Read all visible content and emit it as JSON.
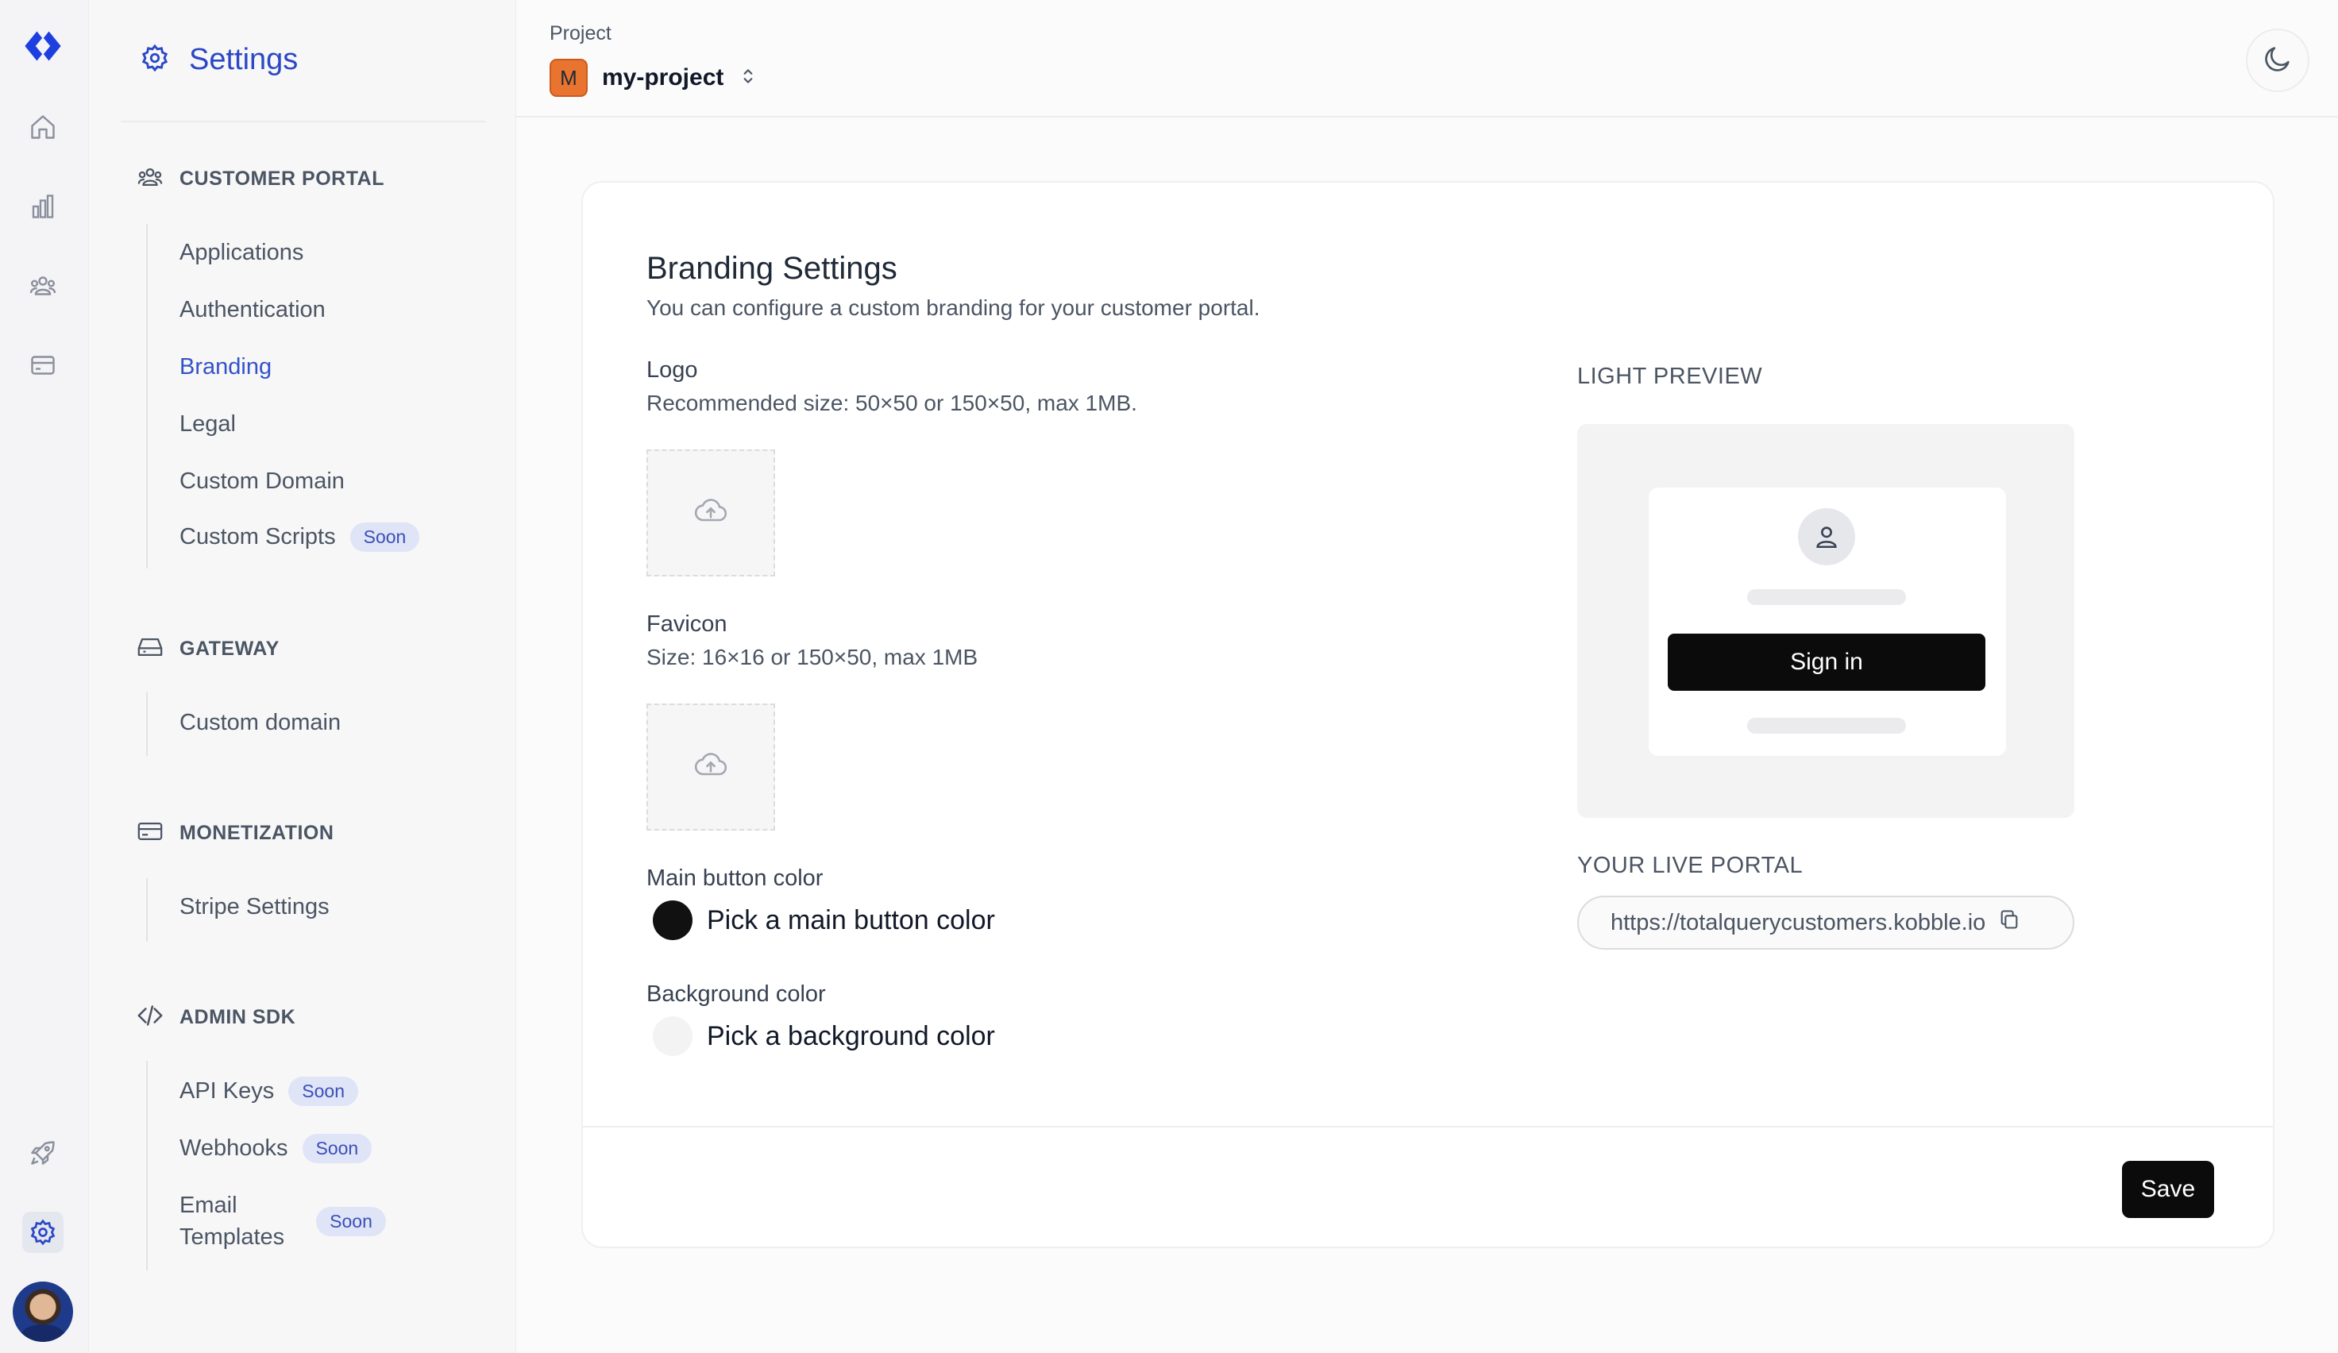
{
  "rail": {
    "icons": [
      "logo-icon",
      "home-icon",
      "analytics-icon",
      "users-icon",
      "billing-icon",
      "rocket-icon",
      "settings-icon"
    ]
  },
  "sidebar": {
    "title": "Settings",
    "sections": [
      {
        "label": "CUSTOMER PORTAL",
        "icon": "users-icon",
        "items": [
          {
            "label": "Applications"
          },
          {
            "label": "Authentication"
          },
          {
            "label": "Branding",
            "active": true
          },
          {
            "label": "Legal"
          },
          {
            "label": "Custom Domain"
          },
          {
            "label": "Custom Scripts",
            "badge": "Soon"
          }
        ]
      },
      {
        "label": "GATEWAY",
        "icon": "drive-icon",
        "items": [
          {
            "label": "Custom domain"
          }
        ]
      },
      {
        "label": "MONETIZATION",
        "icon": "card-icon",
        "items": [
          {
            "label": "Stripe Settings"
          }
        ]
      },
      {
        "label": "ADMIN SDK",
        "icon": "code-icon",
        "items": [
          {
            "label": "API Keys",
            "badge": "Soon"
          },
          {
            "label": "Webhooks",
            "badge": "Soon"
          },
          {
            "label_line1": "Email",
            "label_line2": "Templates",
            "badge": "Soon"
          }
        ]
      }
    ]
  },
  "header": {
    "project_label": "Project",
    "project_initial": "M",
    "project_name": "my-project"
  },
  "branding": {
    "title": "Branding Settings",
    "subtitle": "You can configure a custom branding for your customer portal.",
    "logo": {
      "title": "Logo",
      "hint": "Recommended size: 50×50 or 150×50, max 1MB."
    },
    "favicon": {
      "title": "Favicon",
      "hint": "Size: 16×16 or 150×50, max 1MB"
    },
    "main_button_color": {
      "title": "Main button color",
      "placeholder": "Pick a main button color",
      "swatch": "#111111"
    },
    "background_color": {
      "title": "Background color",
      "placeholder": "Pick a background color",
      "swatch": "#f3f3f4"
    },
    "preview_label": "LIGHT PREVIEW",
    "preview_signin": "Sign in",
    "live_portal_label": "YOUR LIVE PORTAL",
    "live_portal_url": "https://totalquerycustomers.kobble.io",
    "save_label": "Save"
  },
  "colors": {
    "accent": "#2b47c6",
    "brand": "#1d3fe0",
    "project_avatar": "#e8742f"
  }
}
